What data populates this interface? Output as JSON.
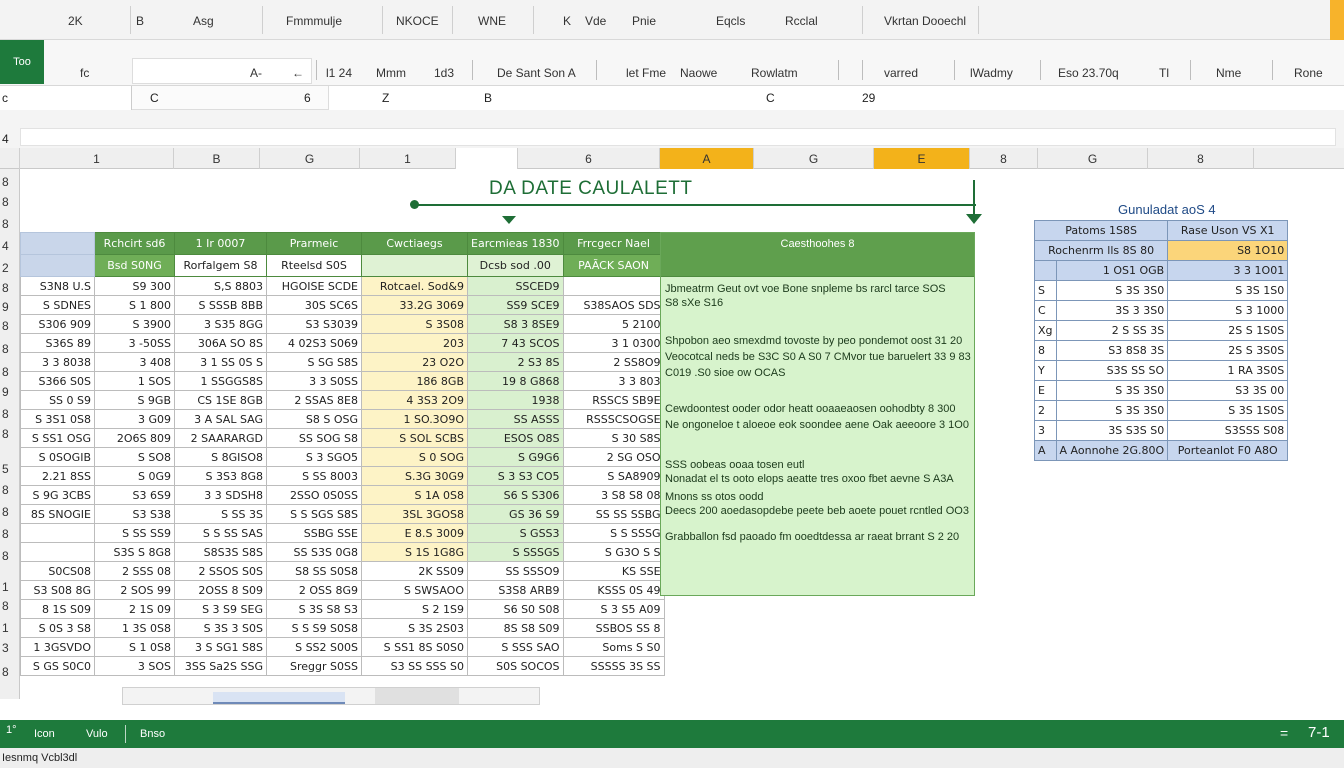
{
  "ribbon": {
    "tabs": [
      "2K",
      "B",
      "Asg",
      "Fmmmulje",
      "NKOCE",
      "WNE",
      "K",
      "Vde",
      "Pnie",
      "Eqcls",
      "Rcclal",
      "Vkrtan Dooechl"
    ]
  },
  "toolbar": {
    "green_tab": "Too",
    "groups": [
      "fc",
      "A-",
      "←",
      "l1 24",
      "Mmm",
      "1d3",
      "De Sant Son A",
      "let Fme",
      "Naowe",
      "Rowlatm",
      "varred",
      "lWadmy",
      "Eso 23.70q",
      "Tl",
      "Nme",
      "Rone"
    ]
  },
  "formula_row": {
    "name_box": "c",
    "labels": [
      "C",
      "6",
      "Z",
      "B",
      "C",
      "29"
    ]
  },
  "side_label": "4",
  "columns": [
    "1",
    "B",
    "G",
    "1",
    "",
    "6",
    "A",
    "G",
    "E",
    "8",
    "G",
    "8"
  ],
  "row_numbers": [
    "8",
    "8",
    "8",
    "4",
    "2",
    "8",
    "9",
    "8",
    "8",
    "8",
    "9",
    "8",
    "8",
    "5",
    "8",
    "8",
    "8",
    "8",
    "1",
    "8",
    "1",
    "3",
    "8"
  ],
  "title": "DA DATE CAULALETT",
  "main_table": {
    "header1": [
      "",
      "Rchcirt sd6",
      "1 Ir 0007",
      "Prarmeic",
      "Cwctiaegs",
      "Earcmieas 1830",
      "Frrcgecr Nael"
    ],
    "header2": [
      "",
      "Bsd S0NG",
      "Rorfalgem S8",
      "Rteelsd S0S",
      "",
      "Dcsb sod .00",
      "PAÃCK SAON"
    ],
    "rows": [
      [
        "S3N8 U.S",
        "S9 300",
        "S,S 8803",
        "HGOISE SCDE",
        "Rotcael. Sod&9",
        "SSCED9",
        ""
      ],
      [
        "S SDNES",
        "S 1 800",
        "S SSSB 8BB",
        "30S SC6S",
        "33.2G 3069",
        "SS9 SCE9",
        "S38SAOS SDS"
      ],
      [
        "S306 909",
        "S 3900",
        "3 S35 8GG",
        "S3 S3039",
        "S 3S08",
        "S8 3 8SE9",
        "5 2100"
      ],
      [
        "S36S 89",
        "3 -50SS",
        "306A SO 8S",
        "4 02S3 S069",
        "203",
        "7 43 SCOS",
        "3 1 0300"
      ],
      [
        "3 3 8038",
        "3 408",
        "3 1 SS 0S S",
        "S SG S8S",
        "23 O2O",
        "2 S3 8S",
        "2 SS8O9"
      ],
      [
        "S366 S0S",
        "1 SOS",
        "1 SSGGS8S",
        "3 3 S0SS",
        "186 8GB",
        "19 8 G868",
        "3 3 803"
      ],
      [
        "SS 0 S9",
        "S 9GB",
        "CS 1SE 8GB",
        "2 SSAS 8E8",
        "4 3S3 2O9",
        "1938",
        "RSSCS SB9E"
      ],
      [
        "S 3S1 0S8",
        "3 G09",
        "3 A SAL SAG",
        "S8 S OSG",
        "1 SO.3O9O",
        "SS ASSS",
        "RSSSCSOGSE"
      ],
      [
        "S SS1 OSG",
        "2O6S 809",
        "2 SAARARGD",
        "SS SOG S8",
        "S SOL SCBS",
        "ESOS O8S",
        "S 30 S8S"
      ],
      [
        "S 0SOGIB",
        "S SO8",
        "S 8GISO8",
        "S 3 SGO5",
        "S 0 SOG",
        "S G9G6",
        "2 SG OSO"
      ],
      [
        "2.21 8SS",
        "S 0G9",
        "S 3S3 8G8",
        "S SS 8003",
        "S.3G 30G9",
        "S 3 S3 CO5",
        "S SA8909"
      ],
      [
        "S 9G 3CBS",
        "S3 6S9",
        "3 3 SDSH8",
        "2SSO 0S0SS",
        "S 1A 0S8",
        "S6 S S306",
        "3 S8 S8 08"
      ],
      [
        "8S SNOGIE",
        "S3 S38",
        "S SS 3S",
        "S S SGS S8S",
        "3SL 3GOS8",
        "GS 36 S9",
        "SS SS SSBG"
      ],
      [
        "",
        "S SS SS9",
        "S S SS SAS",
        "SSBG SSE",
        "E 8.S 3009",
        "S GSS3",
        "S S SSSG"
      ],
      [
        "",
        "S3S S 8G8",
        "S8S3S S8S",
        "SS S3S 0G8",
        "S 1S 1G8G",
        "S SSSGS",
        "S G3O S S"
      ],
      [
        "S0CS08",
        "2 SSS 08",
        "2 SSOS S0S",
        "S8 SS S0S8",
        "2K SS09",
        "SS SSSO9",
        "KS SSE"
      ],
      [
        "S3 S08 8G",
        "2 SOS 99",
        "2OSS 8 S09",
        "2 OSS 8G9",
        "S SWSAOO",
        "S3S8 ARB9",
        "KSSS 0S 49"
      ],
      [
        "8 1S S09",
        "2 1S 09",
        "S 3 S9 SEG",
        "S 3S S8 S3",
        "S 2 1S9",
        "S6 S0 S08",
        "S 3 S5 A09"
      ],
      [
        "S 0S 3 S8",
        "1 3S 0S8",
        "S 3S 3 S0S",
        "S S S9 S0S8",
        "S 3S 2S03",
        "8S S8 S09",
        "SSBOS SS 8"
      ],
      [
        "1 3GSVDO",
        "S 1 0S8",
        "3 S SG1 S8S",
        "S SS2 S00S",
        "S SS1 8S S0S0",
        "S SSS SAO",
        "Soms S S0"
      ],
      [
        "S GS S0C0",
        "3 SOS",
        "3SS Sa2S SSG",
        "Sreggr S0SS",
        "S3 SS SSS S0",
        "S0S SOCOS",
        "SSSSS 3S SS"
      ]
    ]
  },
  "notes": {
    "header": "Caesthoohes 8",
    "lines": [
      "Jbmeatrm Geut ovt voe Bone snpleme bs rarcl tarce SOS",
      "S8 sXe S16",
      "Shpobon aeo smexdmd tovoste by peo pondemot oost 31 20",
      "Veocotcal neds be S3C S0 A S0 7 CMvor tue baruelert 33 9 83",
      "C019 .S0 sioe ow OCAS",
      "Cewdoontest ooder odor heatt ooaaeaosen oohodbty 8 300",
      "Ne ongoneloe t aloeoe eok soondee aene Oak aeeoore 3 1O0",
      "SSS oobeas ooaa tosen eutl",
      "Nonadat el ts ooto elops aeatte tres oxoo fbet aevne S A3A",
      "Mnons ss otos oodd",
      "Deecs 200 aoedasopdebe peete beb aoete pouet rcntled OO3",
      "Grabballon fsd paoado fm ooedtdessa ar raeat brrant S 2 20"
    ]
  },
  "summary": {
    "title": "Gunuladat aoS 4",
    "header": [
      "Patoms 1S8S",
      "Rase Uson VS X1"
    ],
    "rows": [
      [
        "",
        "Rochenrm lls 8S 80",
        "S8 1O10"
      ],
      [
        "",
        "1 OS1 OGB",
        "3 3 1O01"
      ],
      [
        "S",
        "S 3S 3S0",
        "S 3S 1S0"
      ],
      [
        "C",
        "3S 3 3S0",
        "S 3 1000"
      ],
      [
        "Xg",
        "2 S SS 3S",
        "2S S 1S0S"
      ],
      [
        "8",
        "S3 8S8 3S",
        "2S S 3S0S"
      ],
      [
        "Y",
        "S3S SS SO",
        "1 RA 3S0S"
      ],
      [
        "E",
        "S 3S 3S0",
        "S3 3S 00"
      ],
      [
        "2",
        "S 3S 3S0",
        "S 3S 1S0S"
      ],
      [
        "3",
        "3S S3S S0",
        "S3SSS S08"
      ]
    ],
    "footer": [
      "A",
      "A Aonnohe 2G.80O",
      "Porteanlot F0 A8O"
    ]
  },
  "statusbar": {
    "left_icon": "1°",
    "items": [
      "Icon",
      "Vulo",
      "Bnso"
    ],
    "right": [
      "=",
      "7-1"
    ]
  },
  "footer_label": "Iesnmq Vcbl3dl"
}
